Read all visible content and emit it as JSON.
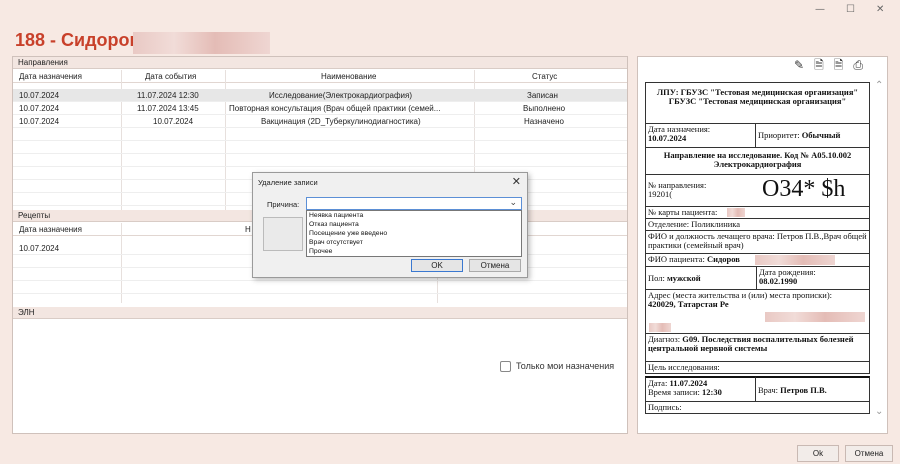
{
  "window": {
    "minimize": "—",
    "maximize": "☐",
    "close": "✕"
  },
  "page_title": "188 - Сидоров",
  "sections": {
    "directions": "Направления",
    "recipes": "Рецепты",
    "eln": "ЭЛН"
  },
  "directions_table": {
    "headers": [
      "Дата назначения",
      "Дата события",
      "Наименование",
      "Статус"
    ],
    "rows": [
      [
        "10.07.2024",
        "11.07.2024 12:30",
        "Исследование(Электрокардиография)",
        "Записан"
      ],
      [
        "10.07.2024",
        "11.07.2024 13:45",
        "Повторная консультация (Врач общей практики (семей...",
        "Выполнено"
      ],
      [
        "10.07.2024",
        "10.07.2024",
        "Вакцинация (2D_Туберкулинодиагностика)",
        "Назначено"
      ]
    ]
  },
  "recipes_table": {
    "headers": [
      "Дата назначения",
      "Н"
    ],
    "rows": [
      [
        "10.07.2024"
      ]
    ]
  },
  "only_mine_label": "Только мои назначения",
  "toolbar_icons": [
    "edit-doc-icon",
    "doc-icon",
    "doc-icon-2",
    "print-icon"
  ],
  "document": {
    "org": "ЛПУ: ГБУЗС \"Тестовая медицинская организация\" ГБУЗС \"Тестовая медицинская организация\"",
    "date_label": "Дата назначения:",
    "date_value": "10.07.2024",
    "priority_label": "Приоритет:",
    "priority_value": "Обычный",
    "referral_title": "Направление на исследование. Код № А05.10.002 Электрокардиография",
    "referral_no_label": "№ направления:",
    "referral_no_value": "19201(",
    "barcode": "O34* $h",
    "card_label": "№ карты пациента:",
    "department": "Отделение: Поликлиника",
    "doctor": "ФИО и должность лечащего врача: Петров П.В.,Врач общей практики (семейный врач)",
    "patient_label": "ФИО пациента:",
    "patient_value": "Сидоров",
    "sex_label": "Пол:",
    "sex_value": "мужской",
    "birth_label": "Дата рождения:",
    "birth_value": "08.02.1990",
    "address_label": "Адрес (места жительства и (или) места прописки):",
    "address_value": "420029, Татарстан Ре",
    "diagnosis_label": "Диагноз:",
    "diagnosis_value": "G09. Последствия воспалительных болезней центральной нервной системы",
    "goal_label": "Цель исследования:",
    "visit_date_label": "Дата:",
    "visit_date_value": "11.07.2024",
    "visit_time_label": "Время записи:",
    "visit_time_value": "12:30",
    "doc_doctor_label": "Врач:",
    "doc_doctor_value": "Петров П.В.",
    "sign_label": "Подпись:"
  },
  "dialog": {
    "title": "Удаление записи",
    "close": "✕",
    "reason_label": "Причина:",
    "options": [
      "Неявка пациента",
      "Отказ пациента",
      "Посещение уже введено",
      "Врач отсутствует",
      "Прочее"
    ],
    "ok": "OK",
    "cancel": "Отмена"
  },
  "footer": {
    "ok": "Ok",
    "cancel": "Отмена"
  }
}
